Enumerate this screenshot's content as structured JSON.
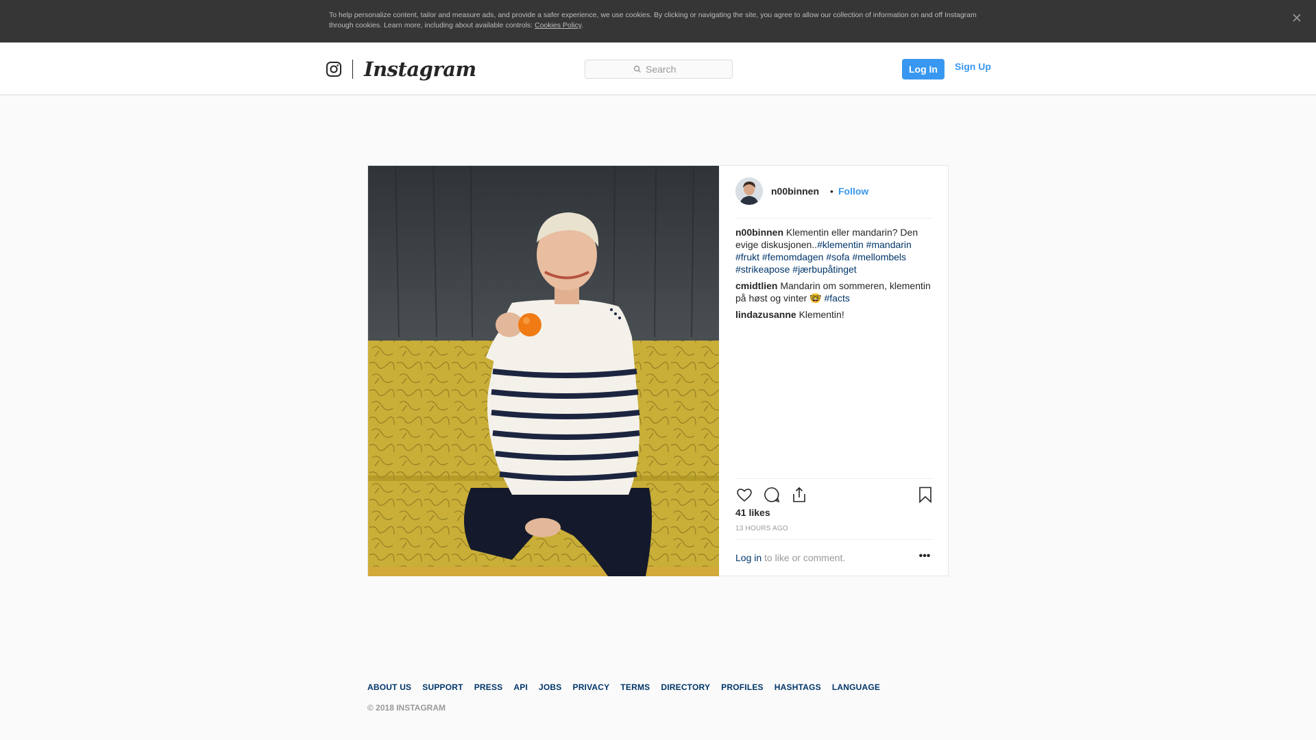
{
  "cookie_banner": {
    "text": "To help personalize content, tailor and measure ads, and provide a safer experience, we use cookies. By clicking or navigating the site, you agree to allow our collection of information on and off Instagram through cookies. Learn more, including about available controls: ",
    "link_text": "Cookies Policy",
    "trailing": ".",
    "close_icon": "close-icon"
  },
  "header": {
    "wordmark": "Instagram",
    "search_placeholder": "Search",
    "login_label": "Log In",
    "signup_label": "Sign Up"
  },
  "post": {
    "username": "n00binnen",
    "separator": "•",
    "follow_label": "Follow",
    "caption_text": "Klementin eller mandarin? Den evige diskusjonen..",
    "caption_tags": [
      "#klementin",
      "#mandarin",
      "#frukt",
      "#femomdagen",
      "#sofa",
      "#mellombels",
      "#strikeapose",
      "#jærbupåtinget"
    ],
    "comments": [
      {
        "user": "cmidtlien",
        "text": "Mandarin om sommeren, klementin på høst og vinter 🤓 ",
        "tag": "#facts"
      },
      {
        "user": "lindazusanne",
        "text": "Klementin!",
        "tag": ""
      }
    ],
    "likes": "41 likes",
    "time_ago": "13 HOURS AGO",
    "login_link": "Log in",
    "login_suffix": " to like or comment.",
    "more_label": "•••"
  },
  "footer": {
    "links": [
      "ABOUT US",
      "SUPPORT",
      "PRESS",
      "API",
      "JOBS",
      "PRIVACY",
      "TERMS",
      "DIRECTORY",
      "PROFILES",
      "HASHTAGS",
      "LANGUAGE"
    ],
    "copyright": "© 2018 INSTAGRAM"
  },
  "colors": {
    "accent": "#3897f0",
    "link_dark": "#003569",
    "banner_bg": "#363636"
  }
}
